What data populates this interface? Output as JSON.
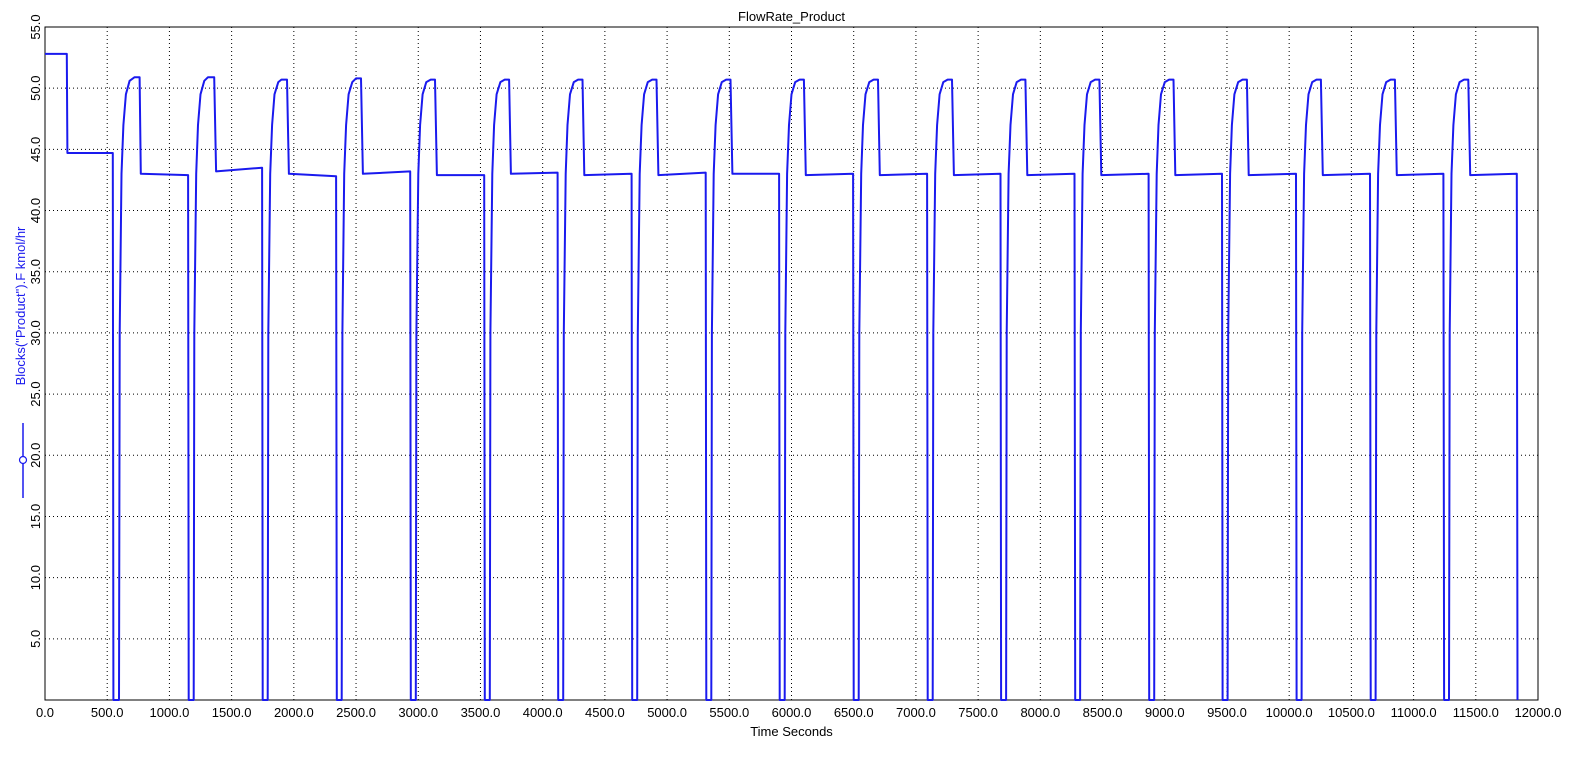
{
  "colors": {
    "series": "#1a1aee",
    "grid": "#000000",
    "axis": "#000000",
    "background": "#ffffff"
  },
  "chart_data": {
    "type": "line",
    "title": "FlowRate_Product",
    "xlabel": "Time Seconds",
    "xlim": [
      0,
      12000
    ],
    "ylim": [
      0,
      55
    ],
    "grid": true,
    "legend": "none",
    "x_ticks": [
      "0.0",
      "500.0",
      "1000.0",
      "1500.0",
      "2000.0",
      "2500.0",
      "3000.0",
      "3500.0",
      "4000.0",
      "4500.0",
      "5000.0",
      "5500.0",
      "6000.0",
      "6500.0",
      "7000.0",
      "7500.0",
      "8000.0",
      "8500.0",
      "9000.0",
      "9500.0",
      "10000.0",
      "10500.0",
      "11000.0",
      "11500.0",
      "12000.0"
    ],
    "y_ticks": [
      "5.0",
      "10.0",
      "15.0",
      "20.0",
      "25.0",
      "30.0",
      "35.0",
      "40.0",
      "45.0",
      "50.0",
      "55.0"
    ],
    "series": [
      {
        "name": "Blocks(\"Product\").F kmol/hr",
        "points": [
          [
            0,
            52.8
          ],
          [
            175,
            52.8
          ],
          [
            180,
            44.7
          ],
          [
            545,
            44.7
          ],
          [
            550,
            0
          ],
          [
            595,
            0
          ],
          [
            600,
            30
          ],
          [
            615,
            43
          ],
          [
            630,
            47
          ],
          [
            650,
            49.5
          ],
          [
            680,
            50.6
          ],
          [
            720,
            50.9
          ],
          [
            760,
            50.9
          ],
          [
            770,
            43
          ],
          [
            1150,
            42.9
          ],
          [
            1155,
            0
          ],
          [
            1195,
            0
          ],
          [
            1200,
            30
          ],
          [
            1215,
            43
          ],
          [
            1230,
            47
          ],
          [
            1250,
            49.5
          ],
          [
            1280,
            50.6
          ],
          [
            1310,
            50.9
          ],
          [
            1360,
            50.9
          ],
          [
            1375,
            43.2
          ],
          [
            1745,
            43.5
          ],
          [
            1750,
            0
          ],
          [
            1790,
            0
          ],
          [
            1795,
            30
          ],
          [
            1810,
            43
          ],
          [
            1825,
            47
          ],
          [
            1845,
            49.5
          ],
          [
            1875,
            50.5
          ],
          [
            1900,
            50.7
          ],
          [
            1945,
            50.7
          ],
          [
            1960,
            43
          ],
          [
            2340,
            42.8
          ],
          [
            2345,
            0
          ],
          [
            2385,
            0
          ],
          [
            2390,
            30
          ],
          [
            2405,
            43
          ],
          [
            2420,
            47
          ],
          [
            2440,
            49.5
          ],
          [
            2470,
            50.5
          ],
          [
            2500,
            50.8
          ],
          [
            2540,
            50.8
          ],
          [
            2555,
            43
          ],
          [
            2935,
            43.2
          ],
          [
            2940,
            0
          ],
          [
            2980,
            0
          ],
          [
            2985,
            30
          ],
          [
            3000,
            43
          ],
          [
            3015,
            47
          ],
          [
            3035,
            49.5
          ],
          [
            3065,
            50.5
          ],
          [
            3100,
            50.7
          ],
          [
            3135,
            50.7
          ],
          [
            3150,
            42.9
          ],
          [
            3530,
            42.9
          ],
          [
            3535,
            0
          ],
          [
            3575,
            0
          ],
          [
            3580,
            30
          ],
          [
            3595,
            43
          ],
          [
            3610,
            47
          ],
          [
            3630,
            49.5
          ],
          [
            3660,
            50.5
          ],
          [
            3695,
            50.7
          ],
          [
            3730,
            50.7
          ],
          [
            3745,
            43
          ],
          [
            4120,
            43.1
          ],
          [
            4125,
            0
          ],
          [
            4165,
            0
          ],
          [
            4170,
            30
          ],
          [
            4185,
            43
          ],
          [
            4200,
            47
          ],
          [
            4220,
            49.5
          ],
          [
            4250,
            50.5
          ],
          [
            4285,
            50.7
          ],
          [
            4320,
            50.7
          ],
          [
            4335,
            42.9
          ],
          [
            4715,
            43
          ],
          [
            4720,
            0
          ],
          [
            4760,
            0
          ],
          [
            4765,
            30
          ],
          [
            4780,
            43
          ],
          [
            4795,
            47
          ],
          [
            4815,
            49.5
          ],
          [
            4845,
            50.5
          ],
          [
            4880,
            50.7
          ],
          [
            4915,
            50.7
          ],
          [
            4930,
            42.9
          ],
          [
            5310,
            43.1
          ],
          [
            5315,
            0
          ],
          [
            5355,
            0
          ],
          [
            5360,
            30
          ],
          [
            5375,
            43
          ],
          [
            5390,
            47
          ],
          [
            5410,
            49.5
          ],
          [
            5440,
            50.5
          ],
          [
            5475,
            50.7
          ],
          [
            5510,
            50.7
          ],
          [
            5525,
            43
          ],
          [
            5900,
            43
          ],
          [
            5905,
            0
          ],
          [
            5945,
            0
          ],
          [
            5950,
            30
          ],
          [
            5965,
            43
          ],
          [
            5980,
            47
          ],
          [
            6000,
            49.5
          ],
          [
            6030,
            50.5
          ],
          [
            6065,
            50.7
          ],
          [
            6100,
            50.7
          ],
          [
            6115,
            42.9
          ],
          [
            6495,
            43
          ],
          [
            6500,
            0
          ],
          [
            6540,
            0
          ],
          [
            6545,
            30
          ],
          [
            6560,
            43
          ],
          [
            6575,
            47
          ],
          [
            6595,
            49.5
          ],
          [
            6625,
            50.5
          ],
          [
            6660,
            50.7
          ],
          [
            6695,
            50.7
          ],
          [
            6710,
            42.9
          ],
          [
            7090,
            43
          ],
          [
            7095,
            0
          ],
          [
            7135,
            0
          ],
          [
            7140,
            30
          ],
          [
            7155,
            43
          ],
          [
            7170,
            47
          ],
          [
            7190,
            49.5
          ],
          [
            7220,
            50.5
          ],
          [
            7255,
            50.7
          ],
          [
            7290,
            50.7
          ],
          [
            7305,
            42.9
          ],
          [
            7680,
            43
          ],
          [
            7685,
            0
          ],
          [
            7725,
            0
          ],
          [
            7730,
            30
          ],
          [
            7745,
            43
          ],
          [
            7760,
            47
          ],
          [
            7780,
            49.5
          ],
          [
            7810,
            50.5
          ],
          [
            7845,
            50.7
          ],
          [
            7880,
            50.7
          ],
          [
            7895,
            42.9
          ],
          [
            8275,
            43
          ],
          [
            8280,
            0
          ],
          [
            8320,
            0
          ],
          [
            8325,
            30
          ],
          [
            8340,
            43
          ],
          [
            8355,
            47
          ],
          [
            8375,
            49.5
          ],
          [
            8405,
            50.5
          ],
          [
            8440,
            50.7
          ],
          [
            8475,
            50.7
          ],
          [
            8490,
            42.9
          ],
          [
            8870,
            43
          ],
          [
            8875,
            0
          ],
          [
            8915,
            0
          ],
          [
            8920,
            30
          ],
          [
            8935,
            43
          ],
          [
            8950,
            47
          ],
          [
            8970,
            49.5
          ],
          [
            9000,
            50.5
          ],
          [
            9035,
            50.7
          ],
          [
            9070,
            50.7
          ],
          [
            9085,
            42.9
          ],
          [
            9460,
            43
          ],
          [
            9465,
            0
          ],
          [
            9505,
            0
          ],
          [
            9510,
            30
          ],
          [
            9525,
            43
          ],
          [
            9540,
            47
          ],
          [
            9560,
            49.5
          ],
          [
            9590,
            50.5
          ],
          [
            9625,
            50.7
          ],
          [
            9660,
            50.7
          ],
          [
            9675,
            42.9
          ],
          [
            10055,
            43
          ],
          [
            10060,
            0
          ],
          [
            10100,
            0
          ],
          [
            10105,
            30
          ],
          [
            10120,
            43
          ],
          [
            10135,
            47
          ],
          [
            10155,
            49.5
          ],
          [
            10185,
            50.5
          ],
          [
            10220,
            50.7
          ],
          [
            10255,
            50.7
          ],
          [
            10270,
            42.9
          ],
          [
            10650,
            43
          ],
          [
            10655,
            0
          ],
          [
            10695,
            0
          ],
          [
            10700,
            30
          ],
          [
            10715,
            43
          ],
          [
            10730,
            47
          ],
          [
            10750,
            49.5
          ],
          [
            10780,
            50.5
          ],
          [
            10815,
            50.7
          ],
          [
            10850,
            50.7
          ],
          [
            10865,
            42.9
          ],
          [
            11240,
            43
          ],
          [
            11245,
            0
          ],
          [
            11285,
            0
          ],
          [
            11290,
            30
          ],
          [
            11305,
            43
          ],
          [
            11320,
            47
          ],
          [
            11340,
            49.5
          ],
          [
            11370,
            50.5
          ],
          [
            11405,
            50.7
          ],
          [
            11440,
            50.7
          ],
          [
            11455,
            42.9
          ],
          [
            11830,
            43
          ],
          [
            11835,
            0
          ]
        ]
      }
    ]
  }
}
